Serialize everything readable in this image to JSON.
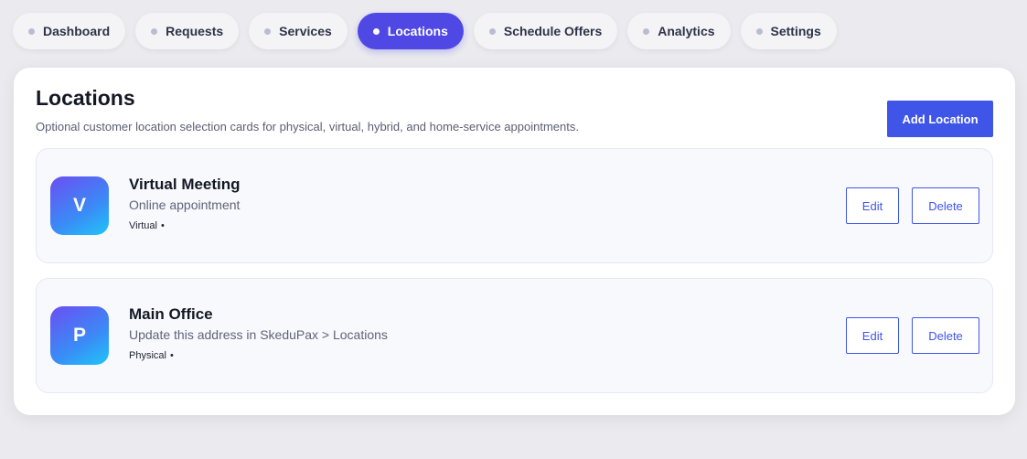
{
  "nav": {
    "tabs": [
      {
        "label": "Dashboard",
        "active": false
      },
      {
        "label": "Requests",
        "active": false
      },
      {
        "label": "Services",
        "active": false
      },
      {
        "label": "Locations",
        "active": true
      },
      {
        "label": "Schedule Offers",
        "active": false
      },
      {
        "label": "Analytics",
        "active": false
      },
      {
        "label": "Settings",
        "active": false
      }
    ]
  },
  "page": {
    "title": "Locations",
    "subtitle": "Optional customer location selection cards for physical, virtual, hybrid, and home-service appointments.",
    "add_label": "Add Location"
  },
  "locations": [
    {
      "initial": "V",
      "name": "Virtual Meeting",
      "description": "Online appointment",
      "type": "Virtual",
      "bullet": "•",
      "edit_label": "Edit",
      "delete_label": "Delete"
    },
    {
      "initial": "P",
      "name": "Main Office",
      "description": "Update this address in SkeduPax > Locations",
      "type": "Physical",
      "bullet": "•",
      "edit_label": "Edit",
      "delete_label": "Delete"
    }
  ],
  "colors": {
    "accent": "#5048e5",
    "button": "#3f55e8",
    "background": "#ebebef"
  }
}
